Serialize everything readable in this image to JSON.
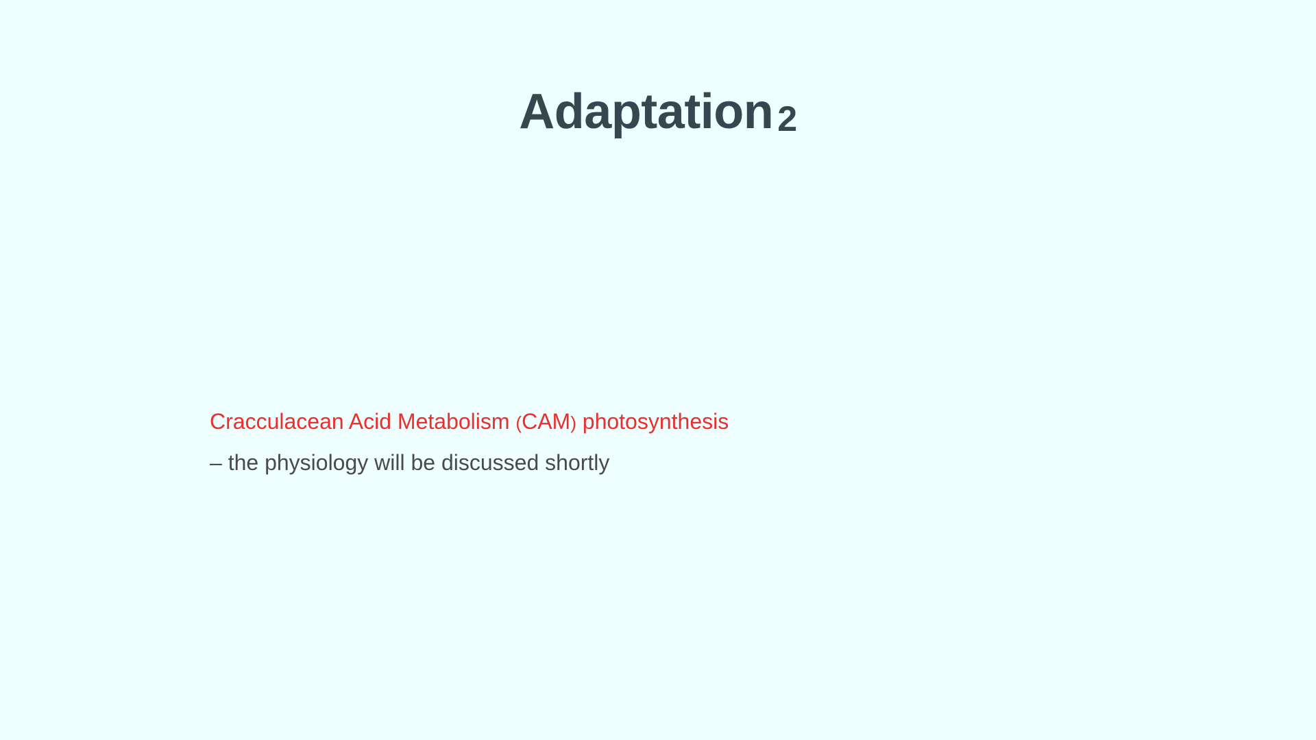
{
  "slide": {
    "title": "Adaptation",
    "title_number": "2",
    "highlight": {
      "part1": "Cracculacean Acid Metabolism ",
      "paren_open": "(",
      "part2": "CAM",
      "paren_close": ")",
      "part3": " photosynthesis"
    },
    "secondary_text": "– the physiology will be discussed shortly"
  },
  "colors": {
    "background": "#effefe",
    "title": "#37474f",
    "highlight": "#e8302d",
    "body": "#4a4a4a"
  }
}
